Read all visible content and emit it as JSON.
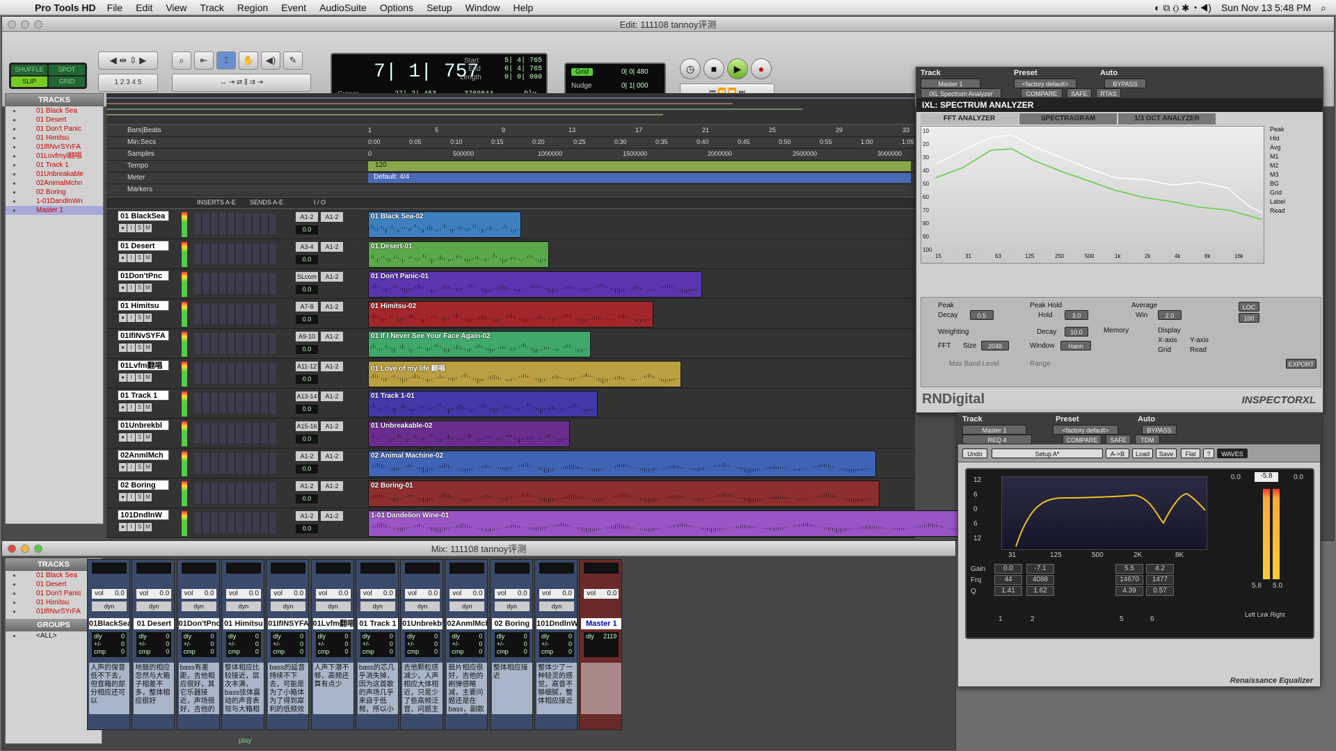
{
  "menubar": {
    "app": "Pro Tools HD",
    "items": [
      "File",
      "Edit",
      "View",
      "Track",
      "Region",
      "Event",
      "AudioSuite",
      "Options",
      "Setup",
      "Window",
      "Help"
    ],
    "clock": "Sun Nov 13  5:48 PM"
  },
  "edit_window": {
    "title": "Edit: 111108 tannoy评测",
    "modes": [
      "SHUFFLE",
      "SPOT",
      "SLIP",
      "GRID"
    ],
    "counter": {
      "main": "7| 1| 757",
      "start_label": "Start",
      "start": "5| 4| 765",
      "end_label": "End",
      "end": "6| 4| 765",
      "length_label": "Length",
      "length": "0| 0| 000",
      "cursor_label": "Cursor",
      "cursor": "27| 2| 453",
      "samples": "3769844",
      "dly": "Dly"
    },
    "grid": {
      "label": "Grid",
      "value": "0| 0| 480",
      "nudge_label": "Nudge",
      "nudge": "0| 1| 000"
    },
    "tracks_header": "TRACKS",
    "track_list": [
      "01 Black Sea",
      "01 Desert",
      "01 Don't Panic",
      "01 Himitsu",
      "01IfINvrSYrFA",
      "01Lovfmyl翻唱",
      "01 Track 1",
      "01Unbreakable",
      "02AnimalMchn",
      "02 Boring",
      "1-01DandlnWn",
      "Master 1"
    ],
    "rulers": {
      "bars_label": "Bars|Beats",
      "minsecs_label": "Min:Secs",
      "samples_label": "Samples",
      "tempo_label": "Tempo",
      "meter_label": "Meter",
      "markers_label": "Markers",
      "bars": [
        "1",
        "5",
        "9",
        "13",
        "17",
        "21",
        "25",
        "29",
        "33"
      ],
      "mins": [
        "0:00",
        "0:05",
        "0:10",
        "0:15",
        "0:20",
        "0:25",
        "0:30",
        "0:35",
        "0:40",
        "0:45",
        "0:50",
        "0:55",
        "1:00",
        "1:05"
      ],
      "samples": [
        "0",
        "500000",
        "1000000",
        "1500000",
        "2000000",
        "2500000",
        "3000000"
      ],
      "tempo": "120",
      "meter": "Default: 4/4"
    },
    "column_headers": {
      "inserts": "INSERTS A-E",
      "sends": "SENDS A-E",
      "io": "I / O"
    },
    "tracks": [
      {
        "name": "01 BlackSea",
        "io1": "A1-2",
        "io2": "A1-2",
        "vol": "0.0",
        "clip": "01 Black Sea-02",
        "clip_color": "#3d7fbf"
      },
      {
        "name": "01 Desert",
        "io1": "A3-4",
        "io2": "A1-2",
        "vol": "0.0",
        "clip": "01 Desert-01",
        "clip_color": "#5ba84a"
      },
      {
        "name": "01Don'tPnc",
        "io1": "SLcom",
        "io2": "A1-2",
        "vol": "0.0",
        "clip": "01 Don't Panic-01",
        "clip_color": "#5a35b0"
      },
      {
        "name": "01 Himitsu",
        "io1": "A7-8",
        "io2": "A1-2",
        "vol": "0.0",
        "clip": "01 Himitsu-02",
        "clip_color": "#a3262a"
      },
      {
        "name": "01IfINvSYFA",
        "io1": "A9-10",
        "io2": "A1-2",
        "vol": "0.0",
        "clip": "01 If I Never See Your Face Again-02",
        "clip_color": "#3fa86a"
      },
      {
        "name": "01Lvfm翻唱",
        "io1": "A11-12",
        "io2": "A1-2",
        "vol": "0.0",
        "clip": "01 Love of my life 翻唱",
        "clip_color": "#bba042"
      },
      {
        "name": "01 Track 1",
        "io1": "A13-14",
        "io2": "A1-2",
        "vol": "0.0",
        "clip": "01 Track 1-01",
        "clip_color": "#4238a8"
      },
      {
        "name": "01Unbrekbl",
        "io1": "A15-16",
        "io2": "A1-2",
        "vol": "0.0",
        "clip": "01 Unbreakable-02",
        "clip_color": "#6a2d8f"
      },
      {
        "name": "02AnmlMch",
        "io1": "A1-2",
        "io2": "A1-2",
        "vol": "0.0",
        "clip": "02 Animal Machine-02",
        "clip_color": "#3f64b5"
      },
      {
        "name": "02 Boring",
        "io1": "A1-2",
        "io2": "A1-2",
        "vol": "0.0",
        "clip": "02 Boring-01",
        "clip_color": "#8e2e2e"
      },
      {
        "name": "101DndlnW",
        "io1": "A1-2",
        "io2": "A1-2",
        "vol": "0.0",
        "clip": "1-01 Dandelion Wine-01",
        "clip_color": "#9a55c4"
      }
    ]
  },
  "inspector": {
    "track_label": "Track",
    "preset_label": "Preset",
    "auto_label": "Auto",
    "track": "Master 1",
    "preset": "<factory default>",
    "bypass": "BYPASS",
    "plugin": "IXL Spectrum Analyzer",
    "compare": "COMPARE",
    "safe": "SAFE",
    "rtas": "RTAS",
    "title": "IXL: SPECTRUM ANALYZER",
    "tabs": [
      "FFT ANALYZER",
      "SPECTRAGRAM",
      "1/3 OCT ANALYZER"
    ],
    "freq_labels": [
      "15",
      "31",
      "63",
      "125",
      "250",
      "500",
      "1k",
      "2k",
      "4k",
      "8k",
      "16k"
    ],
    "db_labels": [
      "10",
      "20",
      "30",
      "40",
      "50",
      "60",
      "70",
      "80",
      "90",
      "100"
    ],
    "legend": [
      "Peak",
      "Hld",
      "Avg",
      "M1",
      "M2",
      "M3",
      "BG",
      "Grid",
      "Label",
      "Read"
    ],
    "controls": {
      "peak": "Peak",
      "decay_label": "Decay",
      "decay": "0.5",
      "peak_hold": "Peak Hold",
      "hold_label": "Hold",
      "hold": "3.0",
      "average": "Average",
      "win_label": "Win",
      "win": "2.0",
      "weighting": "Weighting",
      "decay2": "10.0",
      "fft": "FFT",
      "size_label": "Size",
      "size": "2048",
      "window_label": "Window",
      "window": "Hann",
      "memory": "Memory",
      "display": "Display",
      "xaxis": "X-axis",
      "yaxis": "Y-axis",
      "grid": "Grid",
      "read": "Read",
      "maxband": "Max Band Level",
      "range": "Range",
      "export": "EXPORT",
      "loc": "LOC",
      "hundred": "100"
    },
    "brand": "RNDigital",
    "product": "INSPECTORXL"
  },
  "req": {
    "track_label": "Track",
    "preset_label": "Preset",
    "auto_label": "Auto",
    "track": "Master 1",
    "preset": "<factory default>",
    "bypass": "BYPASS",
    "plugin": "REQ 4",
    "compare": "COMPARE",
    "safe": "SAFE",
    "tdm": "TDM",
    "undo": "Undo",
    "setup": "Setup A*",
    "ab": "A->B",
    "load": "Load",
    "save": "Save",
    "flat": "Flat",
    "help": "?",
    "waves": "WAVES",
    "db_scale": [
      "12",
      "6",
      "0",
      "6",
      "12"
    ],
    "freq_scale": [
      "31",
      "125",
      "500",
      "2K",
      "8K"
    ],
    "gain_label": "Gain",
    "frq_label": "Frq",
    "q_label": "Q",
    "bands": [
      {
        "gain": "0.0",
        "frq": "44",
        "q": "1.41"
      },
      {
        "gain": "-7.1",
        "frq": "4088",
        "q": "1.62"
      },
      {
        "gain": "5.5",
        "frq": "14670",
        "q": "4.39"
      },
      {
        "gain": "4.2",
        "frq": "1477",
        "q": "0.57"
      }
    ],
    "band_nums": [
      "1",
      "2",
      "5",
      "6"
    ],
    "out_left": "0.0",
    "out_trim": "-5.8",
    "out_right": "0.0",
    "meter_l": "5.8",
    "meter_r": "5.0",
    "link": "Left  Link  Right",
    "footer": "Renaissance Equalizer"
  },
  "mix_window": {
    "title": "Mix: 111108 tannoy评测",
    "tracks_header": "TRACKS",
    "groups_header": "GROUPS",
    "group_all": "<ALL>",
    "track_list": [
      "01 Black Sea",
      "01 Desert",
      "01 Don't Panic",
      "01 Himitsu",
      "01IfINvrSYrFA"
    ],
    "vol_label": "vol",
    "dyn": "dyn",
    "strips": [
      {
        "name": "01BlackSea",
        "vol": "0.0",
        "comment": "人声的保音低不下去，但音箱的部分相应还可以"
      },
      {
        "name": "01 Desert",
        "vol": "0.0",
        "comment": "地鼓的相应忽然与大箱子相差不多，整体相应很好"
      },
      {
        "name": "01Don'tPnc",
        "vol": "0.0",
        "comment": "bass有差距，吉他相应很好，其它乐器接近，声场很好，吉他的del ay听到很到"
      },
      {
        "name": "01 Himitsu",
        "vol": "0.0",
        "comment": "整体相应比较接近，层次丰满，bass弦体震动的声音表现与大箱相去甚远"
      },
      {
        "name": "01IfINSYFA",
        "vol": "0.0",
        "comment": "bass的延音持续不下去，可能是为了小箱体为了得到犀利的低频效果故意缩紧低"
      },
      {
        "name": "01Lvfm翻唱",
        "vol": "0.0",
        "comment": "人声下潜不够，高频还算有点少"
      },
      {
        "name": "01 Track 1",
        "vol": "0.0",
        "comment": "bass的芯几乎消失掉，因为这首歌的声场几乎来自于低频，所以小箱的声场"
      },
      {
        "name": "01Unbrekbl",
        "vol": "0.0",
        "comment": "吉他颗粒感减少，人声相应大体相近，只是少了些高频泛音，问题主要还是在ba"
      },
      {
        "name": "02AnmlMch",
        "vol": "0.0",
        "comment": "鼓片相应很好，吉他的刷弹感略减，主要问题还是在bass，副歌部分暴起的动态"
      },
      {
        "name": "02 Boring",
        "vol": "0.0",
        "comment": "整体相应接近"
      },
      {
        "name": "101DndlnW",
        "vol": "0.0",
        "comment": "整体少了一种轻灵的感觉，高音不够细腻，整体相应接近"
      },
      {
        "name": "Master 1",
        "vol": "0.0",
        "comment": ""
      }
    ],
    "master_dly": "2119",
    "sub_labels": [
      "dly",
      "+/-",
      "cmp"
    ],
    "sub_vals": [
      "0",
      "0",
      "0"
    ],
    "play": "play"
  },
  "colors": {
    "accent_green": "#7c2",
    "meter_red": "#f33",
    "master_strip": "#6a2a2a"
  },
  "chart_data": {
    "type": "line",
    "title": "IXL: SPECTRUM ANALYZER",
    "x": [
      "15",
      "31",
      "63",
      "125",
      "250",
      "500",
      "1k",
      "2k",
      "4k",
      "8k",
      "16k"
    ],
    "series": [],
    "ylim": [
      10,
      100
    ]
  }
}
